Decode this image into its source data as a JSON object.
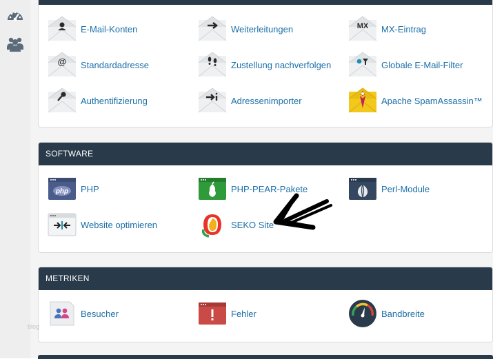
{
  "sidebar": {
    "items": [
      {
        "icon": "speedometer-icon",
        "label": ""
      },
      {
        "icon": "users-icon",
        "label": ""
      }
    ]
  },
  "email": {
    "items": [
      {
        "label": "E-Mail-Konten",
        "icon": "user-envelope-icon"
      },
      {
        "label": "Weiterleitungen",
        "icon": "forward-envelope-icon"
      },
      {
        "label": "MX-Eintrag",
        "icon": "mx-envelope-icon"
      },
      {
        "label": "Standardadresse",
        "icon": "at-envelope-icon"
      },
      {
        "label": "Zustellung nachverfolgen",
        "icon": "footprints-envelope-icon"
      },
      {
        "label": "Globale E-Mail-Filter",
        "icon": "filter-envelope-icon"
      },
      {
        "label": "Authentifizierung",
        "icon": "key-envelope-icon"
      },
      {
        "label": "Adressenimporter",
        "icon": "import-envelope-icon"
      },
      {
        "label": "Apache SpamAssassin™",
        "icon": "spamassassin-icon"
      }
    ]
  },
  "software": {
    "title": "SOFTWARE",
    "items": [
      {
        "label": "PHP",
        "icon": "php-icon"
      },
      {
        "label": "PHP-PEAR-Pakete",
        "icon": "pear-icon"
      },
      {
        "label": "Perl-Module",
        "icon": "perl-onion-icon"
      },
      {
        "label": "Website optimieren",
        "icon": "optimize-icon"
      },
      {
        "label": "SEKO Site",
        "icon": "seko-logo-icon"
      }
    ]
  },
  "metrics": {
    "title": "METRIKEN",
    "items": [
      {
        "label": "Besucher",
        "icon": "visitors-icon"
      },
      {
        "label": "Fehler",
        "icon": "error-icon"
      },
      {
        "label": "Bandbreite",
        "icon": "bandwidth-gauge-icon"
      }
    ]
  },
  "watermark": "blog",
  "annotation": {
    "icon": "hand-drawn-arrow-icon"
  },
  "colors": {
    "header": "#293a4a",
    "link": "#1b6fa8",
    "panel_bg": "#ffffff",
    "page_bg": "#f4f4f4",
    "sidebar_bg": "#eeeeee"
  }
}
